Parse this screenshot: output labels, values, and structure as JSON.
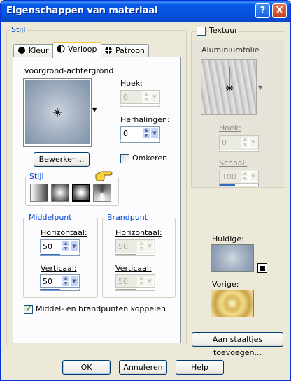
{
  "window": {
    "title": "Eigenschappen van materiaal",
    "help_glyph": "?",
    "close_glyph": "X"
  },
  "style_group": {
    "legend": "Stijl",
    "tabs": [
      {
        "label": "Kleur",
        "icon": "circle-icon"
      },
      {
        "label": "Verloop",
        "icon": "half-circle-icon"
      },
      {
        "label": "Patroon",
        "icon": "pattern-icon"
      }
    ],
    "gradient_name": "voorgrond-achtergrond",
    "hoek_label": "Hoek:",
    "hoek_value": "0",
    "herhalingen_label": "Herhalingen:",
    "herhalingen_value": "0",
    "bewerken_label": "Bewerken...",
    "omkeren_label": "Omkeren",
    "stijl_sub_legend": "Stijl",
    "middelpunt_legend": "Middelpunt",
    "brandpunt_legend": "Brandpunt",
    "horizontaal_label": "Horizontaal:",
    "horizontaal_value": "50",
    "verticaal_label": "Verticaal:",
    "verticaal_value": "50",
    "bp_horizontaal_label": "Horizontaal:",
    "bp_horizontaal_value": "50",
    "bp_verticaal_label": "Verticaal:",
    "bp_verticaal_value": "50",
    "koppelen_label": "Middel- en brandpunten koppelen",
    "koppelen_checked": true
  },
  "texture": {
    "label": "Textuur",
    "checked": false,
    "name": "Aluminiumfolie",
    "hoek_label": "Hoek:",
    "hoek_value": "0",
    "schaal_label": "Schaal:",
    "schaal_value": "100"
  },
  "swatches": {
    "huidige_label": "Huidige:",
    "vorige_label": "Vorige:"
  },
  "buttons": {
    "add_swatch": "Aan staaltjes toevoegen...",
    "ok": "OK",
    "cancel": "Annuleren",
    "help": "Help"
  }
}
